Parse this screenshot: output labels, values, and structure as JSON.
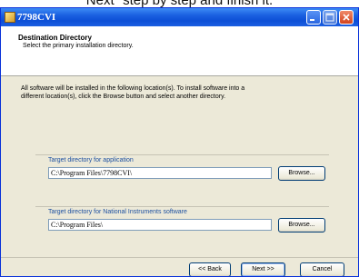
{
  "caption": "Next\" step by step and finish it.",
  "window": {
    "title": "7798CVI",
    "header_title": "Destination Directory",
    "header_subtitle": "Select the primary installation directory."
  },
  "description": {
    "line1": "All software will be installed in the following location(s). To install software into a",
    "line2": "different location(s), click the Browse button and select another directory."
  },
  "app_dir": {
    "label": "Target directory for application",
    "value": "C:\\Program Files\\7798CVI\\",
    "browse_label": "Browse..."
  },
  "ni_dir": {
    "label": "Target directory for National Instruments software",
    "value": "C:\\Program Files\\",
    "browse_label": "Browse..."
  },
  "nav": {
    "back_label": "<< Back",
    "next_label": "Next >>",
    "cancel_label": "Cancel"
  },
  "icons": {
    "app": "installer-icon",
    "minimize": "minimize-icon",
    "maximize": "maximize-icon",
    "close": "close-icon"
  },
  "colors": {
    "titlebar": "#1a5fe0",
    "close_button": "#d2421c",
    "group_label": "#1c4fa0"
  }
}
